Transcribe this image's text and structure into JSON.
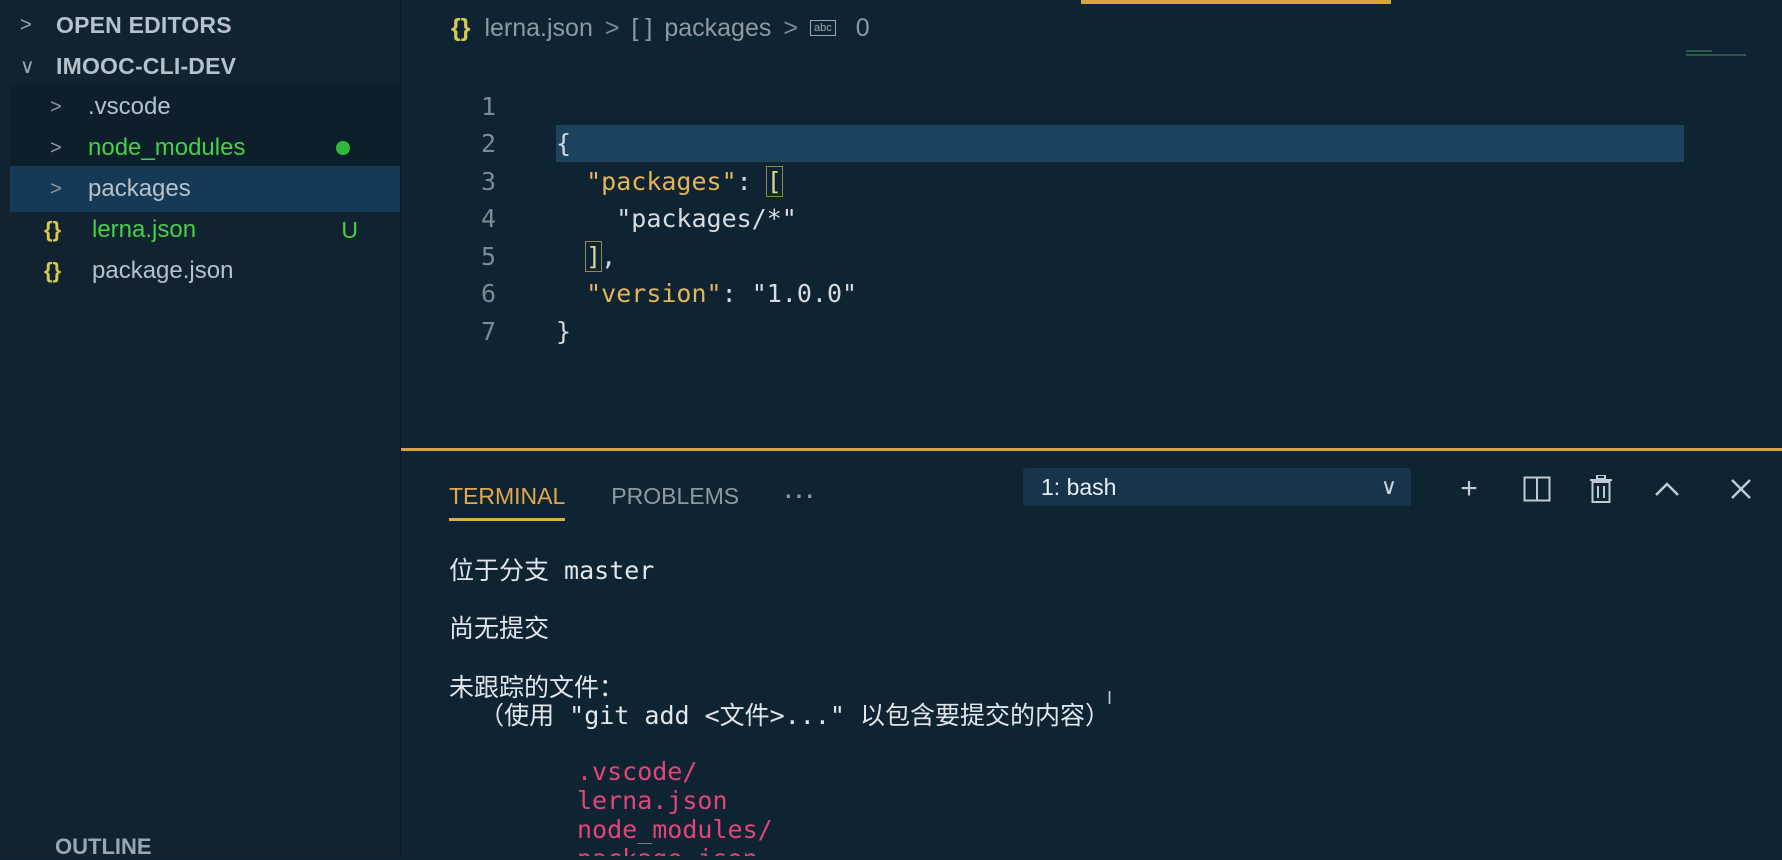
{
  "explorer": {
    "open_editors": "OPEN EDITORS",
    "project": "IMOOC-CLI-DEV",
    "items": [
      {
        "label": ".vscode"
      },
      {
        "label": "node_modules"
      },
      {
        "label": "packages"
      },
      {
        "label": "lerna.json",
        "badge": "U"
      },
      {
        "label": "package.json"
      }
    ],
    "outline": "OUTLINE"
  },
  "breadcrumb": {
    "file": "lerna.json",
    "array_label": "[ ]",
    "packages": "packages",
    "index": "0"
  },
  "editor": {
    "lines": [
      {
        "n": "1"
      },
      {
        "n": "2"
      },
      {
        "n": "3"
      },
      {
        "n": "4"
      },
      {
        "n": "5"
      },
      {
        "n": "6"
      },
      {
        "n": "7"
      }
    ],
    "code": {
      "open_brace": "{",
      "packages_key": "\"packages\"",
      "colon": ": ",
      "open_bracket": "[",
      "packages_value": "\"packages/*\"",
      "close_bracket": "]",
      "comma": ",",
      "version_key": "\"version\"",
      "version_value": "\"1.0.0\"",
      "close_brace": "}"
    }
  },
  "panel": {
    "tabs": [
      "TERMINAL",
      "PROBLEMS",
      "···"
    ],
    "shell": "1: bash",
    "terminal": {
      "branch": "位于分支 master",
      "no_commits": "尚无提交",
      "untracked": "未跟踪的文件：",
      "hint": "  （使用 \"git add <文件>...\" 以包含要提交的内容）",
      "files": [
        ".vscode/",
        "lerna.json",
        "node_modules/",
        "package.json"
      ]
    }
  },
  "colors": {
    "accent": "#d7a53b",
    "untracked_green": "#45d147",
    "terminal_red": "#e3457a",
    "selection": "#163a56"
  }
}
